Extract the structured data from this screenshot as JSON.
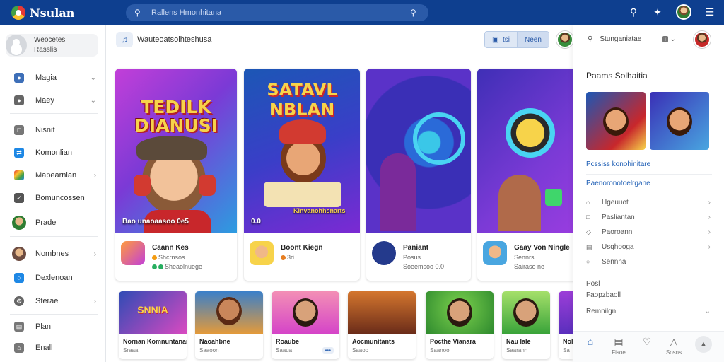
{
  "app": {
    "name": "Nsulan"
  },
  "search": {
    "placeholder": "Rallens Hmonhitana"
  },
  "sidebar": {
    "profile": {
      "line1": "Weocetes",
      "line2": "Rasslis"
    },
    "items": [
      {
        "label": "Magia",
        "icon": "user-icon",
        "color": "#3d6fb8",
        "chevron": true
      },
      {
        "label": "Maey",
        "icon": "people-icon",
        "color": "#555555",
        "chevron": true
      },
      {
        "label": "Nisnit",
        "icon": "calendar-icon",
        "color": "#555555",
        "chevron": false
      },
      {
        "label": "Komonlian",
        "icon": "share-icon",
        "color": "#1e88e5",
        "chevron": false
      },
      {
        "label": "Mapearnian",
        "icon": "apps-icon",
        "color": "#e53935",
        "chevron": true
      },
      {
        "label": "Bomuncossen",
        "icon": "check-icon",
        "color": "#555555",
        "chevron": false
      },
      {
        "label": "Prade",
        "icon": "avatar-icon",
        "color": "#2e7d32",
        "chevron": false
      },
      {
        "label": "Nombnes",
        "icon": "avatar-icon",
        "color": "#6d4c41",
        "chevron": true
      },
      {
        "label": "Dexlenoan",
        "icon": "globe-icon",
        "color": "#1e88e5",
        "chevron": false
      },
      {
        "label": "Sterae",
        "icon": "gear-icon",
        "color": "#555555",
        "chevron": true
      },
      {
        "label": "Plan",
        "icon": "document-icon",
        "color": "#555555",
        "chevron": false
      },
      {
        "label": "Enall",
        "icon": "home-icon",
        "color": "#555555",
        "chevron": false
      }
    ]
  },
  "main": {
    "breadcrumb": "Wauteoatsoihteshusa",
    "segment": {
      "left": "tsi",
      "right": "Neen"
    },
    "cards": [
      {
        "banner_title": "TEDILK DIANUSI",
        "caption": "Bao unaoaasoo 0e5",
        "name": "Caann Kes",
        "meta": "Shcrnsos",
        "meta2": "Sheaolnuege",
        "colors": [
          "#b93cd6",
          "#2d9ce0"
        ],
        "title_color": "#f7d34a"
      },
      {
        "banner_title": "SATAVL NBLAN",
        "caption": "0.0",
        "caption2": "Kinvanohhsnarts",
        "name": "Boont Kiegn",
        "meta": "3ri",
        "colors": [
          "#1c57b5",
          "#7b2ad3"
        ],
        "title_color": "#f7d34a"
      },
      {
        "banner_title": "",
        "caption": "",
        "name": "Paniant",
        "meta": "Posus",
        "meta2": "Soeemsoo 0.0",
        "colors": [
          "#2a2d9c",
          "#5a32c8"
        ],
        "title_color": "#ffffff"
      },
      {
        "banner_title": "",
        "caption": "",
        "name": "Gaay Von Ningle",
        "meta": "Sennrs",
        "meta2": "Sairaso ne",
        "colors": [
          "#3f2fb6",
          "#9b3de0"
        ],
        "title_color": "#ffffff"
      }
    ],
    "thumbs": [
      {
        "title": "Nornan Komnuntanant",
        "meta": "Sraaa",
        "colors": [
          "#2f4bb5",
          "#d94ac1"
        ],
        "label": "SNNIA"
      },
      {
        "title": "Naoahbne",
        "meta": "Saaoon",
        "colors": [
          "#e39a3b",
          "#3a7fc9"
        ],
        "label": ""
      },
      {
        "title": "Roaube",
        "meta": "Saaua",
        "colors": [
          "#d544c8",
          "#f38fb5"
        ],
        "label": ""
      },
      {
        "title": "Aocmunitants",
        "meta": "Saaoo",
        "colors": [
          "#6b2c19",
          "#d4762e"
        ],
        "label": ""
      },
      {
        "title": "Pocthe Vianara",
        "meta": "Saanoo",
        "colors": [
          "#2e8a2e",
          "#7cd14d"
        ],
        "label": ""
      },
      {
        "title": "Nau lale",
        "meta": "Saarann",
        "colors": [
          "#3aa43a",
          "#a5e06a"
        ],
        "label": ""
      },
      {
        "title": "Nol",
        "meta": "Sa",
        "colors": [
          "#5a2fbd",
          "#9c3ed8"
        ],
        "label": ""
      }
    ]
  },
  "right_panel": {
    "search_text": "Stunganiatae",
    "option_label": "i",
    "title": "Paams Solhaitia",
    "link1": "Pcssiss konohinitare",
    "link2": "Paenoronotoelrgane",
    "items": [
      {
        "label": "Hgeuuot",
        "icon": "home-icon"
      },
      {
        "label": "Pasliantan",
        "icon": "lock-icon"
      },
      {
        "label": "Paoroann",
        "icon": "share-icon"
      },
      {
        "label": "Usqhooga",
        "icon": "document-icon"
      },
      {
        "label": "Sennna",
        "icon": "pin-icon"
      }
    ],
    "static1": "Posl",
    "static2": "Faopzbaoll",
    "static3": "Remnilgn",
    "bottom_nav": [
      {
        "label": "",
        "icon": "home-icon",
        "active": true
      },
      {
        "label": "Fisoe",
        "icon": "document-icon"
      },
      {
        "label": "",
        "icon": "heart-icon"
      },
      {
        "label": "Sosns",
        "icon": "bell-icon"
      },
      {
        "label": "",
        "icon": "warning-icon"
      }
    ]
  }
}
